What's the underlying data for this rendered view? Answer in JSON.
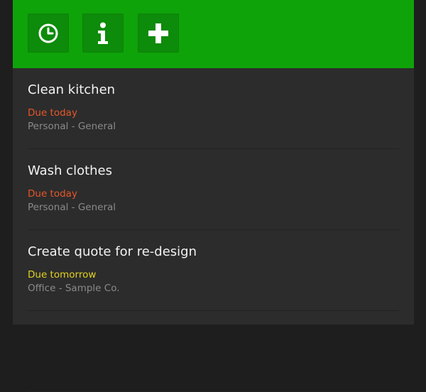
{
  "toolbar": {
    "background": "#0fa30a",
    "button_bg": "#0d8b0a",
    "buttons": [
      {
        "icon": "clock-icon"
      },
      {
        "icon": "info-icon"
      },
      {
        "icon": "plus-icon"
      }
    ]
  },
  "colors": {
    "due_today": "#e8562a",
    "due_tomorrow": "#e3d21f",
    "category": "#8a8a8a",
    "title": "#f2f2f2"
  },
  "tasks": [
    {
      "title": "Clean kitchen",
      "due": "Due today",
      "due_status": "today",
      "category": "Personal - General"
    },
    {
      "title": "Wash clothes",
      "due": "Due today",
      "due_status": "today",
      "category": "Personal - General"
    },
    {
      "title": "Create quote for re-design",
      "due": "Due tomorrow",
      "due_status": "tomorrow",
      "category": "Office - Sample Co."
    },
    {
      "title": "",
      "due": "",
      "due_status": "",
      "category": ""
    }
  ]
}
